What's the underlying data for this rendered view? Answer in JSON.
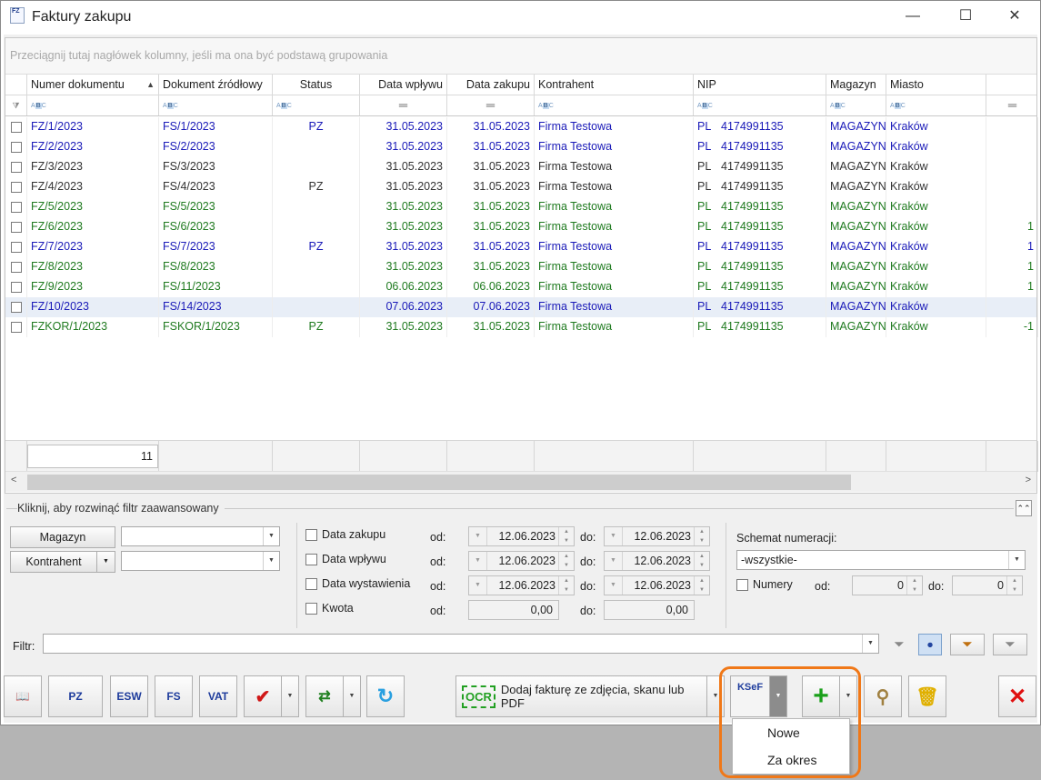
{
  "window": {
    "title": "Faktury zakupu",
    "icon_text": "FZ"
  },
  "grid": {
    "group_hint": "Przeciągnij tutaj nagłówek kolumny, jeśli ma ona być podstawą grupowania",
    "columns": [
      "Numer dokumentu",
      "Dokument źródłowy",
      "Status",
      "Data wpływu",
      "Data zakupu",
      "Kontrahent",
      "NIP",
      "Magazyn",
      "Miasto"
    ],
    "sort_indicator": "▲",
    "rows": [
      {
        "num": "FZ/1/2023",
        "src": "FS/1/2023",
        "status": "PZ",
        "wplyw": "31.05.2023",
        "zakup": "31.05.2023",
        "kontrahent": "Firma Testowa",
        "kraj": "PL",
        "nip": "4174991135",
        "magazyn": "MAGAZYN",
        "miasto": "Kraków",
        "extra": "",
        "color": "blue"
      },
      {
        "num": "FZ/2/2023",
        "src": "FS/2/2023",
        "status": "",
        "wplyw": "31.05.2023",
        "zakup": "31.05.2023",
        "kontrahent": "Firma Testowa",
        "kraj": "PL",
        "nip": "4174991135",
        "magazyn": "MAGAZYN",
        "miasto": "Kraków",
        "extra": "",
        "color": "blue"
      },
      {
        "num": "FZ/3/2023",
        "src": "FS/3/2023",
        "status": "",
        "wplyw": "31.05.2023",
        "zakup": "31.05.2023",
        "kontrahent": "Firma Testowa",
        "kraj": "PL",
        "nip": "4174991135",
        "magazyn": "MAGAZYN",
        "miasto": "Kraków",
        "extra": "",
        "color": "dark"
      },
      {
        "num": "FZ/4/2023",
        "src": "FS/4/2023",
        "status": "PZ",
        "wplyw": "31.05.2023",
        "zakup": "31.05.2023",
        "kontrahent": "Firma Testowa",
        "kraj": "PL",
        "nip": "4174991135",
        "magazyn": "MAGAZYN",
        "miasto": "Kraków",
        "extra": "",
        "color": "dark"
      },
      {
        "num": "FZ/5/2023",
        "src": "FS/5/2023",
        "status": "",
        "wplyw": "31.05.2023",
        "zakup": "31.05.2023",
        "kontrahent": "Firma Testowa",
        "kraj": "PL",
        "nip": "4174991135",
        "magazyn": "MAGAZYN",
        "miasto": "Kraków",
        "extra": "",
        "color": "green"
      },
      {
        "num": "FZ/6/2023",
        "src": "FS/6/2023",
        "status": "",
        "wplyw": "31.05.2023",
        "zakup": "31.05.2023",
        "kontrahent": "Firma Testowa",
        "kraj": "PL",
        "nip": "4174991135",
        "magazyn": "MAGAZYN",
        "miasto": "Kraków",
        "extra": "1",
        "color": "green"
      },
      {
        "num": "FZ/7/2023",
        "src": "FS/7/2023",
        "status": "PZ",
        "wplyw": "31.05.2023",
        "zakup": "31.05.2023",
        "kontrahent": "Firma Testowa",
        "kraj": "PL",
        "nip": "4174991135",
        "magazyn": "MAGAZYN",
        "miasto": "Kraków",
        "extra": "1",
        "color": "blue"
      },
      {
        "num": "FZ/8/2023",
        "src": "FS/8/2023",
        "status": "",
        "wplyw": "31.05.2023",
        "zakup": "31.05.2023",
        "kontrahent": "Firma Testowa",
        "kraj": "PL",
        "nip": "4174991135",
        "magazyn": "MAGAZYN",
        "miasto": "Kraków",
        "extra": "1",
        "color": "green"
      },
      {
        "num": "FZ/9/2023",
        "src": "FS/11/2023",
        "status": "",
        "wplyw": "06.06.2023",
        "zakup": "06.06.2023",
        "kontrahent": "Firma Testowa",
        "kraj": "PL",
        "nip": "4174991135",
        "magazyn": "MAGAZYN",
        "miasto": "Kraków",
        "extra": "1",
        "color": "green"
      },
      {
        "num": "FZ/10/2023",
        "src": "FS/14/2023",
        "status": "",
        "wplyw": "07.06.2023",
        "zakup": "07.06.2023",
        "kontrahent": "Firma Testowa",
        "kraj": "PL",
        "nip": "4174991135",
        "magazyn": "MAGAZYN",
        "miasto": "Kraków",
        "extra": "",
        "color": "blue"
      },
      {
        "num": "FZKOR/1/2023",
        "src": "FSKOR/1/2023",
        "status": "PZ",
        "wplyw": "31.05.2023",
        "zakup": "31.05.2023",
        "kontrahent": "Firma Testowa",
        "kraj": "PL",
        "nip": "4174991135",
        "magazyn": "MAGAZYN",
        "miasto": "Kraków",
        "extra": "-1",
        "color": "green"
      }
    ],
    "selected_row": 9,
    "count": "11"
  },
  "filters": {
    "advanced_label": "Kliknij, aby rozwinąć filtr zaawansowany",
    "magazyn_label": "Magazyn",
    "kontrahent_label": "Kontrahent",
    "date_rows": [
      {
        "label": "Data zakupu",
        "od": "12.06.2023",
        "do": "12.06.2023"
      },
      {
        "label": "Data wpływu",
        "od": "12.06.2023",
        "do": "12.06.2023"
      },
      {
        "label": "Data wystawienia",
        "od": "12.06.2023",
        "do": "12.06.2023"
      },
      {
        "label": "Kwota",
        "od": "0,00",
        "do": "0,00"
      }
    ],
    "od_label": "od:",
    "do_label": "do:",
    "schemat_label": "Schemat numeracji:",
    "schemat_value": "-wszystkie-",
    "numery_label": "Numery",
    "numery_od": "0",
    "numery_do": "0",
    "filtr_label": "Filtr:"
  },
  "toolbar": {
    "pz": "PZ",
    "esw": "ESW",
    "fs": "FS",
    "vat": "VAT",
    "ocr_icon": "OCR",
    "ocr_label": "Dodaj fakturę ze zdjęcia, skanu lub PDF",
    "ksef": "KSeF"
  },
  "ksef_menu": {
    "items": [
      "Nowe",
      "Za okres"
    ]
  },
  "colors": {
    "blue": "#1a1ab8",
    "green": "#1f7a1f",
    "highlight": "#f07818"
  }
}
